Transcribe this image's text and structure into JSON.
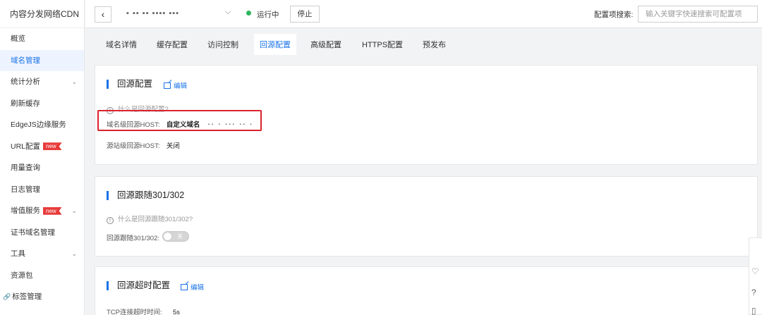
{
  "brand": "内容分发网络CDN",
  "sidebar": {
    "items": [
      {
        "label": "概览"
      },
      {
        "label": "域名管理",
        "active": true
      },
      {
        "label": "统计分析",
        "chevron": true
      },
      {
        "label": "刷新缓存"
      },
      {
        "label": "EdgeJS边缘服务"
      },
      {
        "label": "URL配置",
        "badge": "new"
      },
      {
        "label": "用量查询"
      },
      {
        "label": "日志管理"
      },
      {
        "label": "增值服务",
        "badge": "new",
        "chevron": true
      },
      {
        "label": "证书域名管理"
      },
      {
        "label": "工具",
        "chevron": true
      },
      {
        "label": "资源包"
      },
      {
        "label": "标签管理",
        "icon": "link-icon"
      }
    ]
  },
  "topbar": {
    "back_icon": "‹",
    "domain_masked": "▪ ▪▪ ▪▪ ▪▪▪▪ ▪▪▪",
    "status": "运行中",
    "status_color": "#2db55d",
    "stop_label": "停止",
    "search_label": "配置项搜索:",
    "search_placeholder": "输入关键字快速搜索可配置项"
  },
  "tabs": [
    {
      "label": "域名详情"
    },
    {
      "label": "缓存配置"
    },
    {
      "label": "访问控制"
    },
    {
      "label": "回源配置",
      "active": true
    },
    {
      "label": "高级配置"
    },
    {
      "label": "HTTPS配置"
    },
    {
      "label": "预发布"
    }
  ],
  "origin_config": {
    "title": "回源配置",
    "edit": "编辑",
    "help": "什么是回源配置?",
    "host_label": "域名级回源HOST:",
    "host_value": "自定义域名",
    "host_masked": "▪▪ ▪ ▪▪▪ ▪▪ ▪",
    "site_host_label": "源站级回源HOST:",
    "site_host_value": "关闭"
  },
  "redirect_config": {
    "title": "回源跟随301/302",
    "help": "什么是回源跟随301/302?",
    "toggle_label": "回源跟随301/302:",
    "toggle_state": "关"
  },
  "timeout_config": {
    "title": "回源超时配置",
    "edit": "编辑",
    "tcp_label": "TCP连接超时时间:",
    "tcp_value": "5s"
  },
  "colors": {
    "accent": "#1a73e8",
    "highlight_border": "#d9232d",
    "badge": "#e83b3b"
  }
}
